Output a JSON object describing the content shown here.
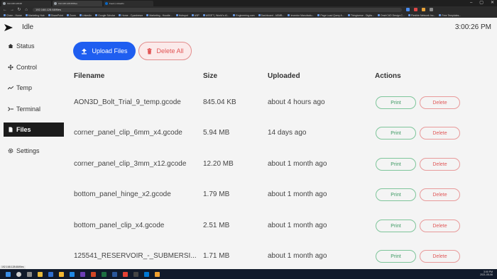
{
  "browser": {
    "tabs": [
      {
        "label": "192.168.128.68"
      },
      {
        "label": "192.168.128.68/files"
      },
      {
        "label": "Feed | LinkedIn"
      }
    ],
    "url": "192.168.128.68/files",
    "status_url": "192.168.128.68/files",
    "bookmarks": [
      "Chem - Home",
      "Marketing Hub",
      "SharePoint",
      "Zoom",
      "LinkedIn",
      "Google Scholar",
      "Home - Cyanbrewz",
      "Marketing - Hoodie...",
      "Hubspot",
      "ASP",
      "ASSET | World's #1...",
      "Engineering.com",
      "Dashboard - ASMB...",
      "Inventor Manufactu...",
      "Page Load Query A...",
      "Thingiverse - Digita...",
      "OnshCAD Design C...",
      "Flexible Network Inc...",
      "Free Templates..."
    ]
  },
  "app": {
    "status": "Idle",
    "clock": "3:00:26 PM"
  },
  "sidebar": {
    "items": [
      {
        "label": "Status",
        "icon": "home-icon"
      },
      {
        "label": "Control",
        "icon": "move-icon"
      },
      {
        "label": "Temp",
        "icon": "chart-icon"
      },
      {
        "label": "Terminal",
        "icon": "terminal-icon"
      },
      {
        "label": "Files",
        "icon": "file-icon"
      },
      {
        "label": "Settings",
        "icon": "gear-icon"
      }
    ]
  },
  "actions": {
    "upload_label": "Upload Files",
    "delete_all_label": "Delete All"
  },
  "table": {
    "headers": [
      "Filename",
      "Size",
      "Uploaded",
      "Actions"
    ],
    "print_label": "Print",
    "delete_label": "Delete",
    "rows": [
      {
        "filename": "AON3D_Bolt_Trial_9_temp.gcode",
        "size": "845.04 KB",
        "uploaded": "about 4 hours ago"
      },
      {
        "filename": "corner_panel_clip_6mm_x4.gcode",
        "size": "5.94 MB",
        "uploaded": "14 days ago"
      },
      {
        "filename": "corner_panel_clip_3mm_x12.gcode",
        "size": "12.20 MB",
        "uploaded": "about 1 month ago"
      },
      {
        "filename": "bottom_panel_hinge_x2.gcode",
        "size": "1.79 MB",
        "uploaded": "about 1 month ago"
      },
      {
        "filename": "bottom_panel_clip_x4.gcode",
        "size": "2.51 MB",
        "uploaded": "about 1 month ago"
      },
      {
        "filename": "125541_RESERVOIR_-_SUBMERSI...",
        "size": "1.71 MB",
        "uploaded": "about 1 month ago"
      }
    ]
  },
  "taskbar": {
    "time": "3:00 PM",
    "date": "2021-05-06"
  },
  "colors": {
    "primary": "#1f5ef0",
    "danger": "#e05a5a",
    "success": "#3d9a63",
    "sidebar_active": "#1c1c1c"
  }
}
